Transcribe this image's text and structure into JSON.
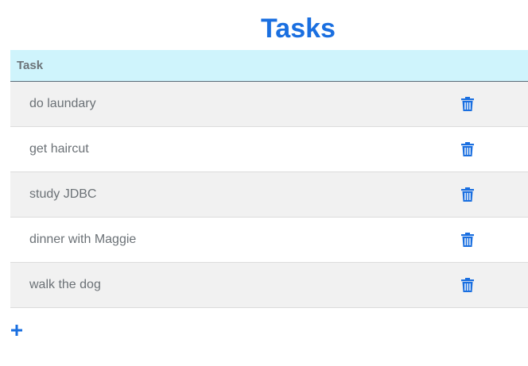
{
  "page": {
    "title": "Tasks"
  },
  "table": {
    "header": "Task",
    "rows": [
      {
        "task": "do laundary"
      },
      {
        "task": "get haircut"
      },
      {
        "task": "study JDBC"
      },
      {
        "task": "dinner with Maggie"
      },
      {
        "task": "walk the dog"
      }
    ]
  },
  "icons": {
    "delete": "trash-icon",
    "add": "plus-icon"
  },
  "colors": {
    "accent": "#1a6fe0",
    "header_bg": "#cff4fc",
    "stripe_bg": "#f1f1f1",
    "text": "#6b7176"
  }
}
